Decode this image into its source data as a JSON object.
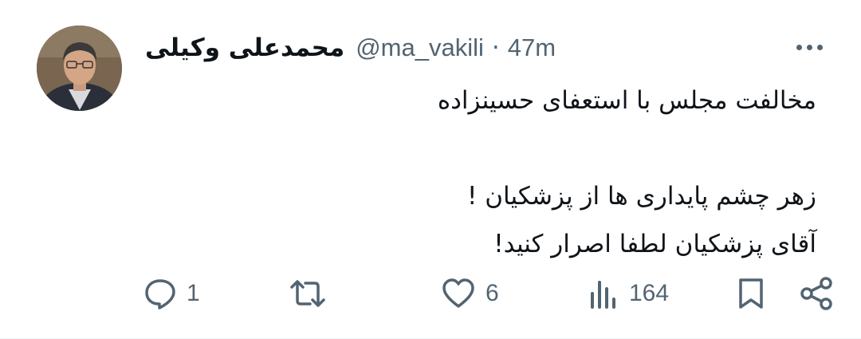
{
  "tweet": {
    "author_name": "محمدعلی وکیلی",
    "handle": "@ma_vakili",
    "separator": "·",
    "time": "47m",
    "lines": [
      "مخالفت مجلس با استعفای حسینزاده",
      "",
      "زهر چشم پایداری ها از پزشکیان !",
      "آقای پزشکیان لطفا اصرار کنید!"
    ]
  },
  "actions": {
    "reply_count": "1",
    "retweet_count": "",
    "like_count": "6",
    "views_count": "164"
  },
  "icons": {
    "reply": "reply-icon",
    "retweet": "retweet-icon",
    "like": "heart-icon",
    "views": "views-icon",
    "bookmark": "bookmark-icon",
    "share": "share-icon",
    "more": "more-icon"
  },
  "colors": {
    "text": "#0f1419",
    "secondary": "#536471",
    "divider": "#eff3f4"
  }
}
